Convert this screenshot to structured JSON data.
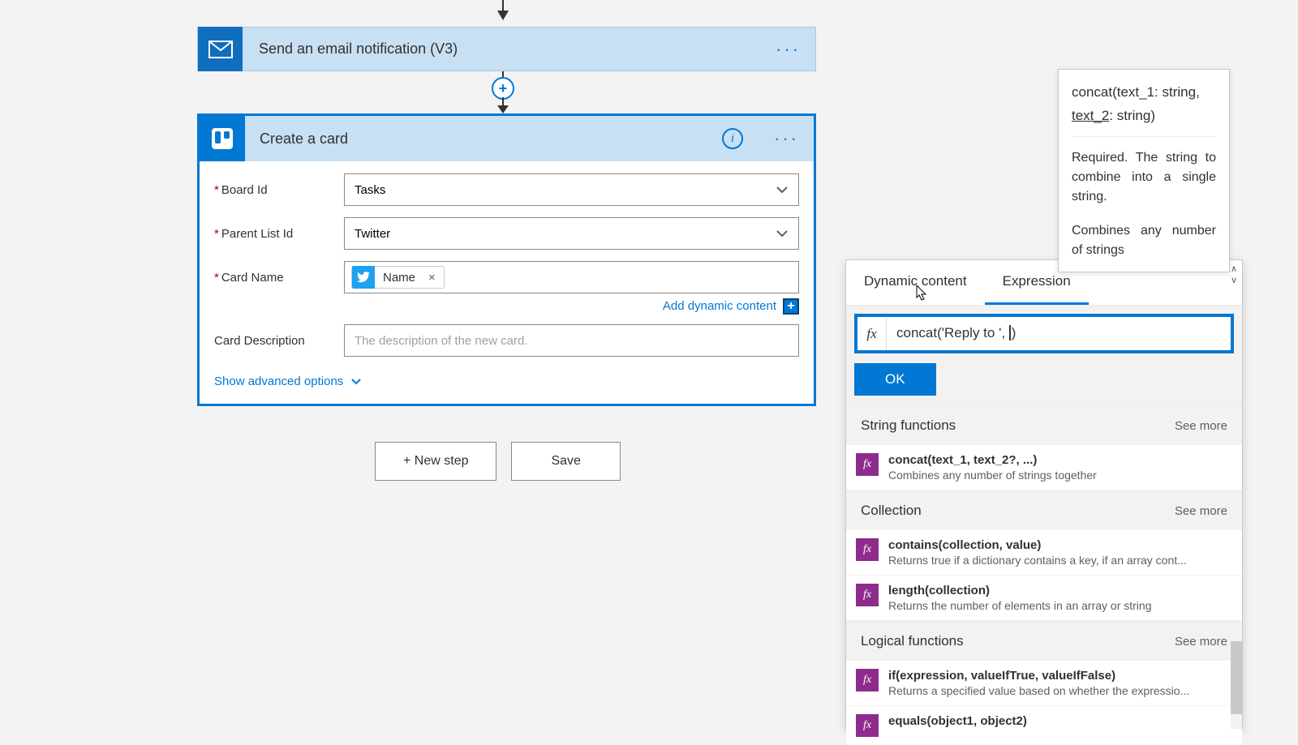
{
  "flow": {
    "email_step_title": "Send an email notification (V3)",
    "create_card_title": "Create a card"
  },
  "form": {
    "board_id_label": "Board Id",
    "board_id_value": "Tasks",
    "parent_list_label": "Parent List Id",
    "parent_list_value": "Twitter",
    "card_name_label": "Card Name",
    "card_name_token": "Name",
    "add_dynamic_label": "Add dynamic content",
    "card_desc_label": "Card Description",
    "card_desc_placeholder": "The description of the new card.",
    "show_advanced": "Show advanced options"
  },
  "buttons": {
    "new_step": "+ New step",
    "save": "Save"
  },
  "panel": {
    "tab_dynamic": "Dynamic content",
    "tab_expression": "Expression",
    "expression_value": "concat('Reply to ', )",
    "fx": "fx",
    "ok": "OK",
    "sections": [
      {
        "title": "String functions",
        "see_more": "See more",
        "items": [
          {
            "sig": "concat(text_1, text_2?, ...)",
            "desc": "Combines any number of strings together"
          }
        ]
      },
      {
        "title": "Collection",
        "see_more": "See more",
        "items": [
          {
            "sig": "contains(collection, value)",
            "desc": "Returns true if a dictionary contains a key, if an array cont..."
          },
          {
            "sig": "length(collection)",
            "desc": "Returns the number of elements in an array or string"
          }
        ]
      },
      {
        "title": "Logical functions",
        "see_more": "See more",
        "items": [
          {
            "sig": "if(expression, valueIfTrue, valueIfFalse)",
            "desc": "Returns a specified value based on whether the expressio..."
          },
          {
            "sig": "equals(object1, object2)",
            "desc": ""
          }
        ]
      }
    ]
  },
  "tooltip": {
    "sig_pre": "concat(text_1: string, ",
    "sig_underline": "text_2",
    "sig_post": ": string)",
    "required": "Required. The string to combine into a single string.",
    "main": "Combines any number of strings"
  }
}
